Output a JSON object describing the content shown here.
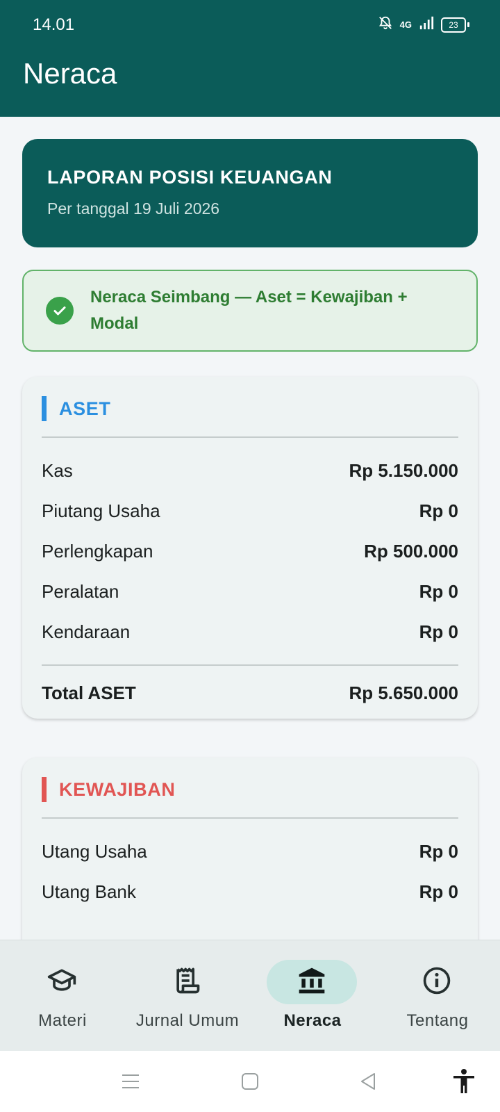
{
  "status": {
    "time": "14.01",
    "network": "4G",
    "battery": "23"
  },
  "app": {
    "title": "Neraca"
  },
  "header": {
    "title": "LAPORAN POSISI KEUANGAN",
    "subtitle": "Per tanggal 19 Juli 2026"
  },
  "banner": {
    "text": "Neraca Seimbang — Aset = Kewajiban + Modal"
  },
  "colors": {
    "primary": "#0b5c59",
    "aset_accent": "#2b8fe0",
    "kewajiban_accent": "#e15553",
    "success": "#2e7d32"
  },
  "aset": {
    "title": "ASET",
    "items": [
      {
        "name": "Kas",
        "amount": "Rp 5.150.000"
      },
      {
        "name": "Piutang Usaha",
        "amount": "Rp 0"
      },
      {
        "name": "Perlengkapan",
        "amount": "Rp 500.000"
      },
      {
        "name": "Peralatan",
        "amount": "Rp 0"
      },
      {
        "name": "Kendaraan",
        "amount": "Rp 0"
      }
    ],
    "total_label": "Total ASET",
    "total_amount": "Rp 5.650.000"
  },
  "kewajiban": {
    "title": "KEWAJIBAN",
    "items": [
      {
        "name": "Utang Usaha",
        "amount": "Rp 0"
      },
      {
        "name": "Utang Bank",
        "amount": "Rp 0"
      }
    ]
  },
  "nav": {
    "items": [
      {
        "label": "Materi",
        "icon": "graduation-cap-icon"
      },
      {
        "label": "Jurnal Umum",
        "icon": "receipt-icon"
      },
      {
        "label": "Neraca",
        "icon": "bank-icon",
        "active": true
      },
      {
        "label": "Tentang",
        "icon": "info-icon"
      }
    ]
  }
}
